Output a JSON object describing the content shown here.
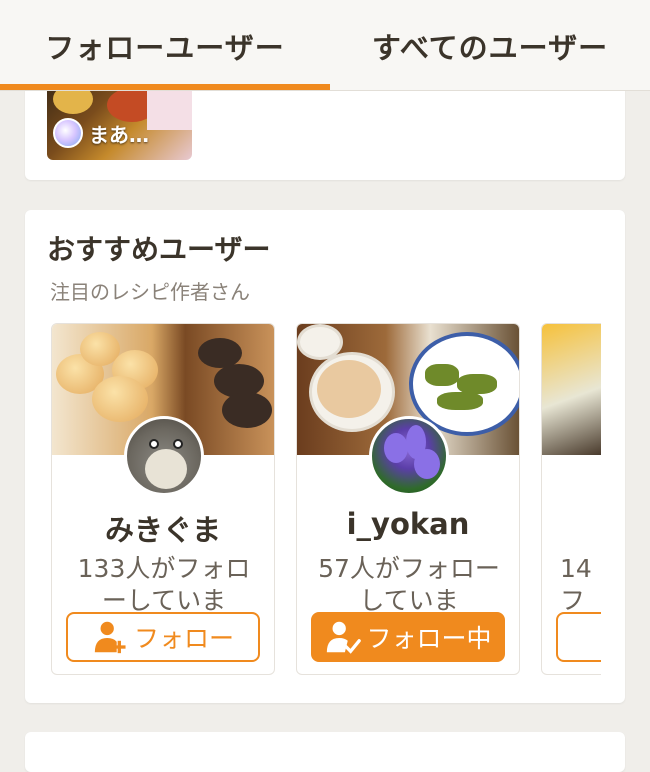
{
  "tabs": [
    {
      "label": "フォローユーザー",
      "active": true
    },
    {
      "label": "すべてのユーザー",
      "active": false
    }
  ],
  "feed_preview": {
    "author_short": "まあ…"
  },
  "recommend": {
    "title": "おすすめユーザー",
    "subtitle": "注目のレシピ作者さん",
    "users": [
      {
        "name": "みきぐま",
        "followers": "133人がフォローしていま",
        "button": "フォロー",
        "following": false
      },
      {
        "name": "i_yokan",
        "followers": "57人がフォローしていま",
        "button": "フォロー中",
        "following": true
      },
      {
        "name": "",
        "followers": "14\nフ",
        "button": "",
        "following": false
      }
    ]
  },
  "colors": {
    "accent": "#f08a1e",
    "background": "#f0eeea",
    "text": "#3b342a"
  },
  "icons": {
    "follow": "person-plus-icon",
    "following": "person-check-icon"
  }
}
